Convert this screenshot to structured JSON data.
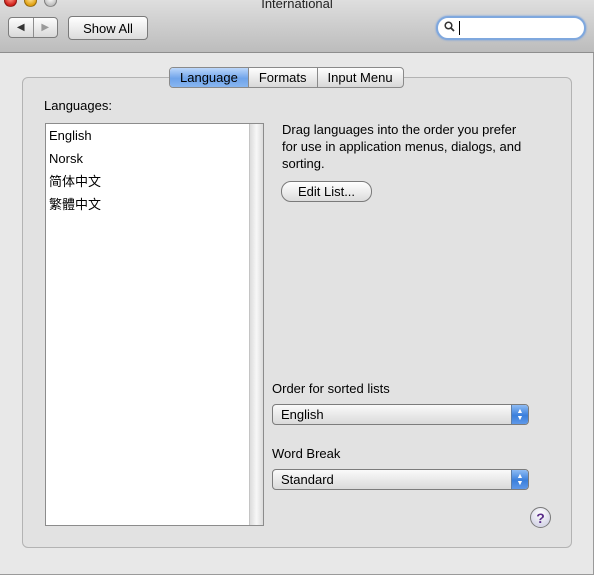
{
  "window": {
    "title": "International"
  },
  "toolbar": {
    "back_glyph": "◀",
    "forward_glyph": "▶",
    "show_all_label": "Show All",
    "search": {
      "value": "",
      "placeholder": ""
    }
  },
  "tabs": [
    {
      "label": "Language",
      "active": true
    },
    {
      "label": "Formats",
      "active": false
    },
    {
      "label": "Input Menu",
      "active": false
    }
  ],
  "languages": {
    "heading": "Languages:",
    "items": [
      "English",
      "Norsk",
      "简体中文",
      "繁體中文"
    ]
  },
  "instructions": {
    "text": "Drag languages into the order you prefer for use in application menus, dialogs, and sorting.",
    "edit_list_label": "Edit List..."
  },
  "sorted_lists": {
    "label": "Order for sorted lists",
    "selected": "English"
  },
  "word_break": {
    "label": "Word Break",
    "selected": "Standard"
  },
  "help": {
    "glyph": "?"
  },
  "colors": {
    "accent": "#6fa4ea",
    "help_glyph": "#5a2d8a"
  }
}
